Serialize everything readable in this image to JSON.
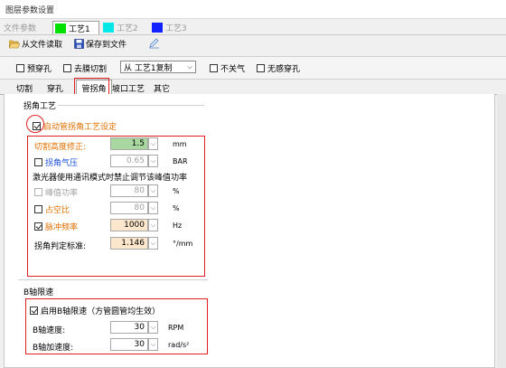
{
  "window": {
    "title": "图层参数设置"
  },
  "top_tabs": [
    {
      "label": "文件参数",
      "color": null,
      "active": false
    },
    {
      "label": "工艺1",
      "color": "#00e000",
      "active": true
    },
    {
      "label": "工艺2",
      "color": "#00e8e8",
      "active": false
    },
    {
      "label": "工艺3",
      "color": "#1020ff",
      "active": false
    }
  ],
  "toolbar": {
    "load_label": "从文件读取",
    "save_label": "保存到文件"
  },
  "options": {
    "pre_pierce": "预穿孔",
    "cut_film": "去膜切割",
    "copy_select": "从 工艺1复制",
    "gas_off": "不关气",
    "no_pierce": "无感穿孔"
  },
  "sub_tabs": [
    "切割",
    "穿孔",
    "管拐角",
    "坡口工艺",
    "其它"
  ],
  "active_sub_tab": "管拐角",
  "corner": {
    "group_title": "拐角工艺",
    "enable_label": "启动管拐角工艺设定",
    "enable_checked": true,
    "height_correction_label": "切割高度修正:",
    "height_correction_value": "1.5",
    "height_unit": "mm",
    "gas_pressure_label": "拐角气压",
    "gas_pressure_value": "0.65",
    "gas_pressure_unit": "BAR",
    "note": "激光器使用通讯模式时禁止调节该峰值功率",
    "peak_power_label": "峰值功率",
    "peak_power_value": "80",
    "peak_power_unit": "%",
    "duty_label": "占空比",
    "duty_value": "80",
    "duty_unit": "%",
    "pulse_freq_label": "脉冲频率",
    "pulse_freq_value": "1000",
    "pulse_freq_checked": true,
    "pulse_freq_unit": "Hz",
    "judge_label": "拐角判定标准:",
    "judge_value": "1.146",
    "judge_unit": "°/mm"
  },
  "b_axis": {
    "group_title": "B轴限速",
    "enable_label": "启用B轴限速（方管圆管均生效）",
    "enable_checked": true,
    "speed_label": "B轴速度:",
    "speed_value": "30",
    "speed_unit": "RPM",
    "accel_label": "B轴加速度:",
    "accel_value": "30",
    "accel_unit": "rad/s²"
  },
  "colors": {
    "highlight": "#e02020",
    "orange_label": "#e07000",
    "blue_label": "#1a4fd8",
    "green_field": "#a8d8a0",
    "orange_field": "#fde7cc"
  }
}
